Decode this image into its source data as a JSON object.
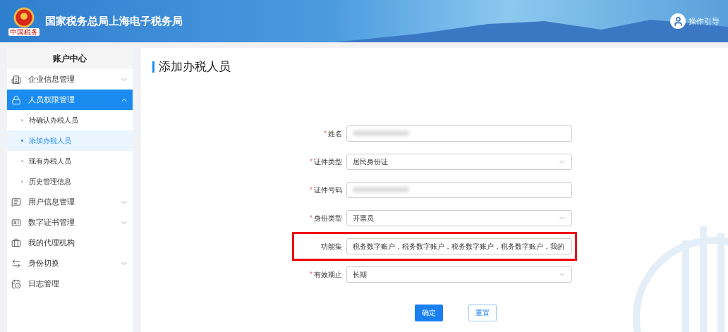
{
  "header": {
    "logo_caption": "中国税务",
    "title": "国家税务总局上海电子税务局",
    "guide": "操作引导"
  },
  "sidebar": {
    "title": "账户中心",
    "items": [
      {
        "label": "企业信息管理",
        "selected": false,
        "expandable": true,
        "expanded": false
      },
      {
        "label": "人员权限管理",
        "selected": true,
        "expandable": true,
        "expanded": true,
        "children": [
          {
            "label": "待确认办税人员",
            "selected": false
          },
          {
            "label": "添加办税人员",
            "selected": true
          },
          {
            "label": "现有办税人员",
            "selected": false
          },
          {
            "label": "历史管理信息",
            "selected": false
          }
        ]
      },
      {
        "label": "用户信息管理",
        "selected": false,
        "expandable": true,
        "expanded": false
      },
      {
        "label": "数字证书管理",
        "selected": false,
        "expandable": true,
        "expanded": false
      },
      {
        "label": "我的代理机构",
        "selected": false,
        "expandable": false
      },
      {
        "label": "身份切换",
        "selected": false,
        "expandable": true,
        "expanded": false
      },
      {
        "label": "日志管理",
        "selected": false,
        "expandable": false
      }
    ]
  },
  "page": {
    "title": "添加办税人员"
  },
  "form": {
    "fields": [
      {
        "label": "姓名",
        "required_mark": "*",
        "kind": "input",
        "redacted": true,
        "highlighted": false
      },
      {
        "label": "证件类型",
        "required_mark": "*",
        "kind": "select",
        "value": "居民身份证",
        "highlighted": false
      },
      {
        "label": "证件号码",
        "required_mark": "*",
        "kind": "input",
        "redacted": true,
        "highlighted": false
      },
      {
        "label": "身份类型",
        "required_mark": "*",
        "kind": "select",
        "value": "开票员",
        "highlighted": false
      },
      {
        "label": "功能集",
        "kind": "input",
        "value": "税务数字账户，税务数字账户，税务数字账户，税务数字账户，我的",
        "highlighted": true
      },
      {
        "label": "有效期止",
        "required_mark": "*",
        "kind": "select",
        "value": "长期",
        "highlighted": false
      }
    ],
    "buttons": [
      {
        "label": "确定",
        "kind": "primary"
      },
      {
        "label": "重置",
        "kind": "secondary"
      }
    ]
  }
}
